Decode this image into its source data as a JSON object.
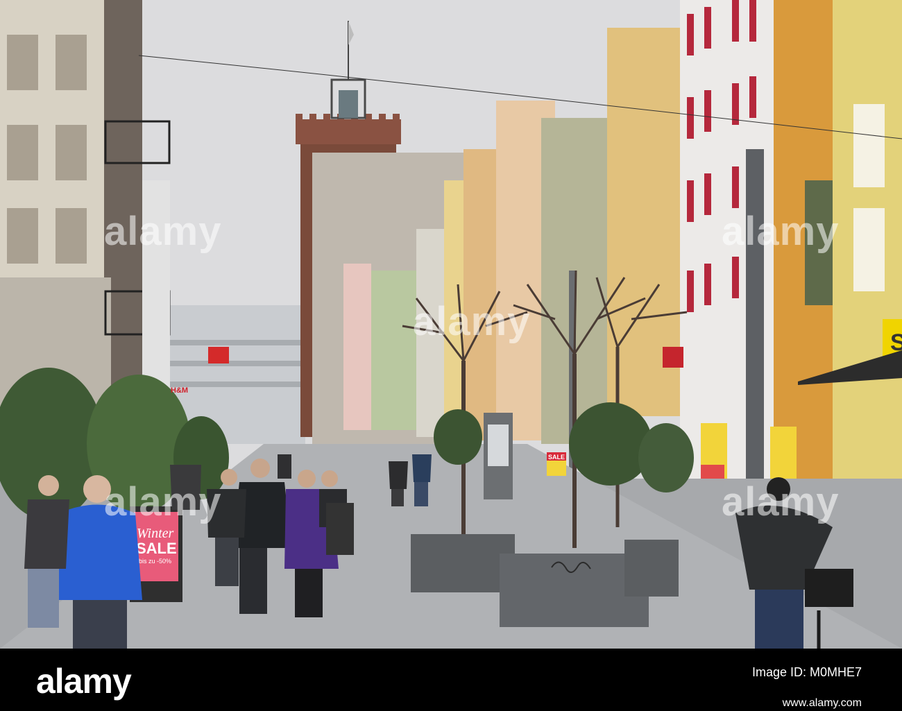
{
  "scene": {
    "description_free": true,
    "colors": {
      "sky": "#dcdcde",
      "tower_brick": "#7a4a3a",
      "pavement": "#a7a9ac",
      "sale_sign": "#e85b7a",
      "yellow_banner": "#f2d43a",
      "blue_jacket": "#2a5fd1"
    }
  },
  "signs": {
    "winter_sale_line1": "Winter",
    "winter_sale_line2": "SALE",
    "winter_sale_line3": "bis zu -50%",
    "store_sale": "SALE",
    "hm": "H&M",
    "shop_letter": "S"
  },
  "watermark": {
    "text": "alamy"
  },
  "footer": {
    "logo": "alamy",
    "image_id_label": "Image ID: M0MHE7",
    "url": "www.alamy.com"
  }
}
